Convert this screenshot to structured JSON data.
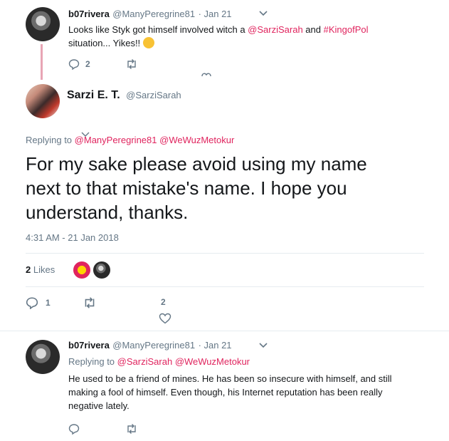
{
  "tweet1": {
    "display_name": "b07rivera",
    "handle": "@ManyPeregrine81",
    "date": "· Jan 21",
    "text_prefix": "Looks like Styk got himself involved witch a ",
    "mention": "@SarziSarah",
    "text_mid": " and ",
    "hashtag": "#KingofPol",
    "text_line2": "situation... Yikes!!",
    "emoji": "🙃",
    "reply_count": "2"
  },
  "main": {
    "display_name": "Sarzi E. T.",
    "handle": "@SarziSarah",
    "replying_to_label": "Replying to",
    "replying_to_1": "@ManyPeregrine81",
    "replying_to_2": "@WeWuzMetokur",
    "text_line1": "For my sake please avoid using my name",
    "text_line2": "next to that mistake's name. I hope you",
    "text_line3": "understand, thanks.",
    "timestamp": "4:31 AM - 21 Jan 2018",
    "likes_count": "2",
    "likes_label": "Likes",
    "reply_count": "1",
    "like_count_action": "2"
  },
  "tweet3": {
    "display_name": "b07rivera",
    "handle": "@ManyPeregrine81",
    "date": "· Jan 21",
    "replying_to_label": "Replying to",
    "replying_to_1": "@SarziSarah",
    "replying_to_2": "@WeWuzMetokur",
    "text_line1": "He used to be a friend of mines. He has been so insecure with himself, and still",
    "text_line2": "making a fool of himself. Even though, his Internet reputation has been really",
    "text_line3": "negative lately."
  },
  "colors": {
    "link": "#e0245e",
    "muted": "#657786",
    "thread_line": "#e8a5b5"
  },
  "icons": [
    "reply-icon",
    "retweet-icon",
    "heart-icon",
    "chevron-down-icon"
  ]
}
